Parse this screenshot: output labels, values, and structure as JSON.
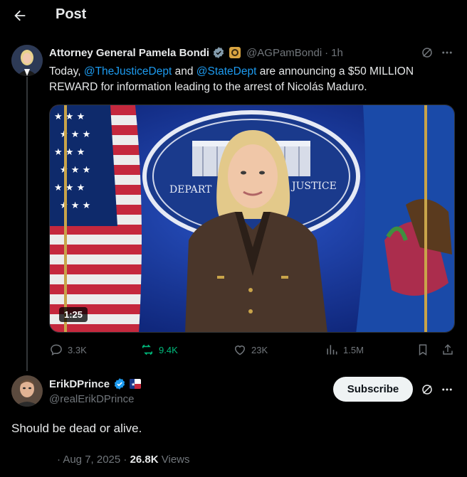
{
  "header": {
    "title": "Post"
  },
  "post": {
    "author_name": "Attorney General Pamela Bondi",
    "handle": "@AGPamBondi",
    "separator": "·",
    "time": "1h",
    "text_before": "Today, ",
    "mention1": "@TheJusticeDept",
    "text_mid": " and ",
    "mention2": "@StateDept",
    "text_line1_end": " are announcing a $50 MILLION",
    "text_line2": "REWARD for information leading to the arrest of Nicolás Maduro.",
    "media": {
      "duration": "1:25",
      "seal_left": "DEPART",
      "seal_right": "JUSTICE"
    },
    "actions": {
      "replies": "3.3K",
      "reposts": "9.4K",
      "likes": "23K",
      "views": "1.5M"
    }
  },
  "reply": {
    "author_name": "ErikDPrince",
    "handle": "@realErikDPrince",
    "subscribe_label": "Subscribe",
    "text": "Should be dead or alive.",
    "meta_prefix": "· Aug 7, 2025 · ",
    "views_count": "26.8K",
    "views_label": " Views"
  },
  "colors": {
    "accent": "#1d9bf0",
    "repost_active": "#00ba7c",
    "muted": "#71767b"
  }
}
